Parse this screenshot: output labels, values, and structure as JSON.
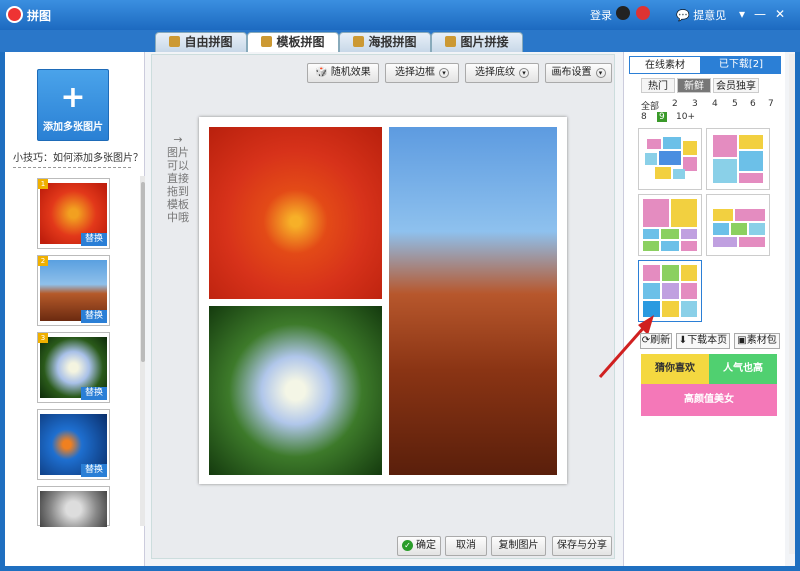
{
  "app": {
    "title": "拼图",
    "login": "登录",
    "feedback": "提意见"
  },
  "tabs": [
    {
      "label": "自由拼图"
    },
    {
      "label": "模板拼图"
    },
    {
      "label": "海报拼图"
    },
    {
      "label": "图片拼接"
    }
  ],
  "left": {
    "add_label": "添加多张图片",
    "tip": "小技巧：如何添加多张图片？",
    "replace": "替换",
    "nums": [
      "1",
      "2",
      "3"
    ]
  },
  "toolbar": {
    "random": "随机效果",
    "border": "选择边框",
    "texture": "选择底纹",
    "canvas": "画布设置"
  },
  "canvas_hint": "图片可以直接拖到模板中哦",
  "bottom": {
    "confirm": "确定",
    "cancel": "取消",
    "copy": "复制图片",
    "save": "保存与分享"
  },
  "right": {
    "tab_online": "在线素材",
    "tab_downloaded": "已下载[2]",
    "chips": [
      "热门",
      "新鲜",
      "会员独享"
    ],
    "count_all": "全部",
    "counts": [
      "2",
      "3",
      "4",
      "5",
      "6",
      "7",
      "8",
      "9",
      "10+"
    ],
    "count_selected": "9",
    "refresh": "刷新",
    "download_page": "下载本页",
    "pack": "素材包",
    "banner1": "猜你喜欢",
    "banner2": "人气也高",
    "banner3": "高颜值美女"
  }
}
